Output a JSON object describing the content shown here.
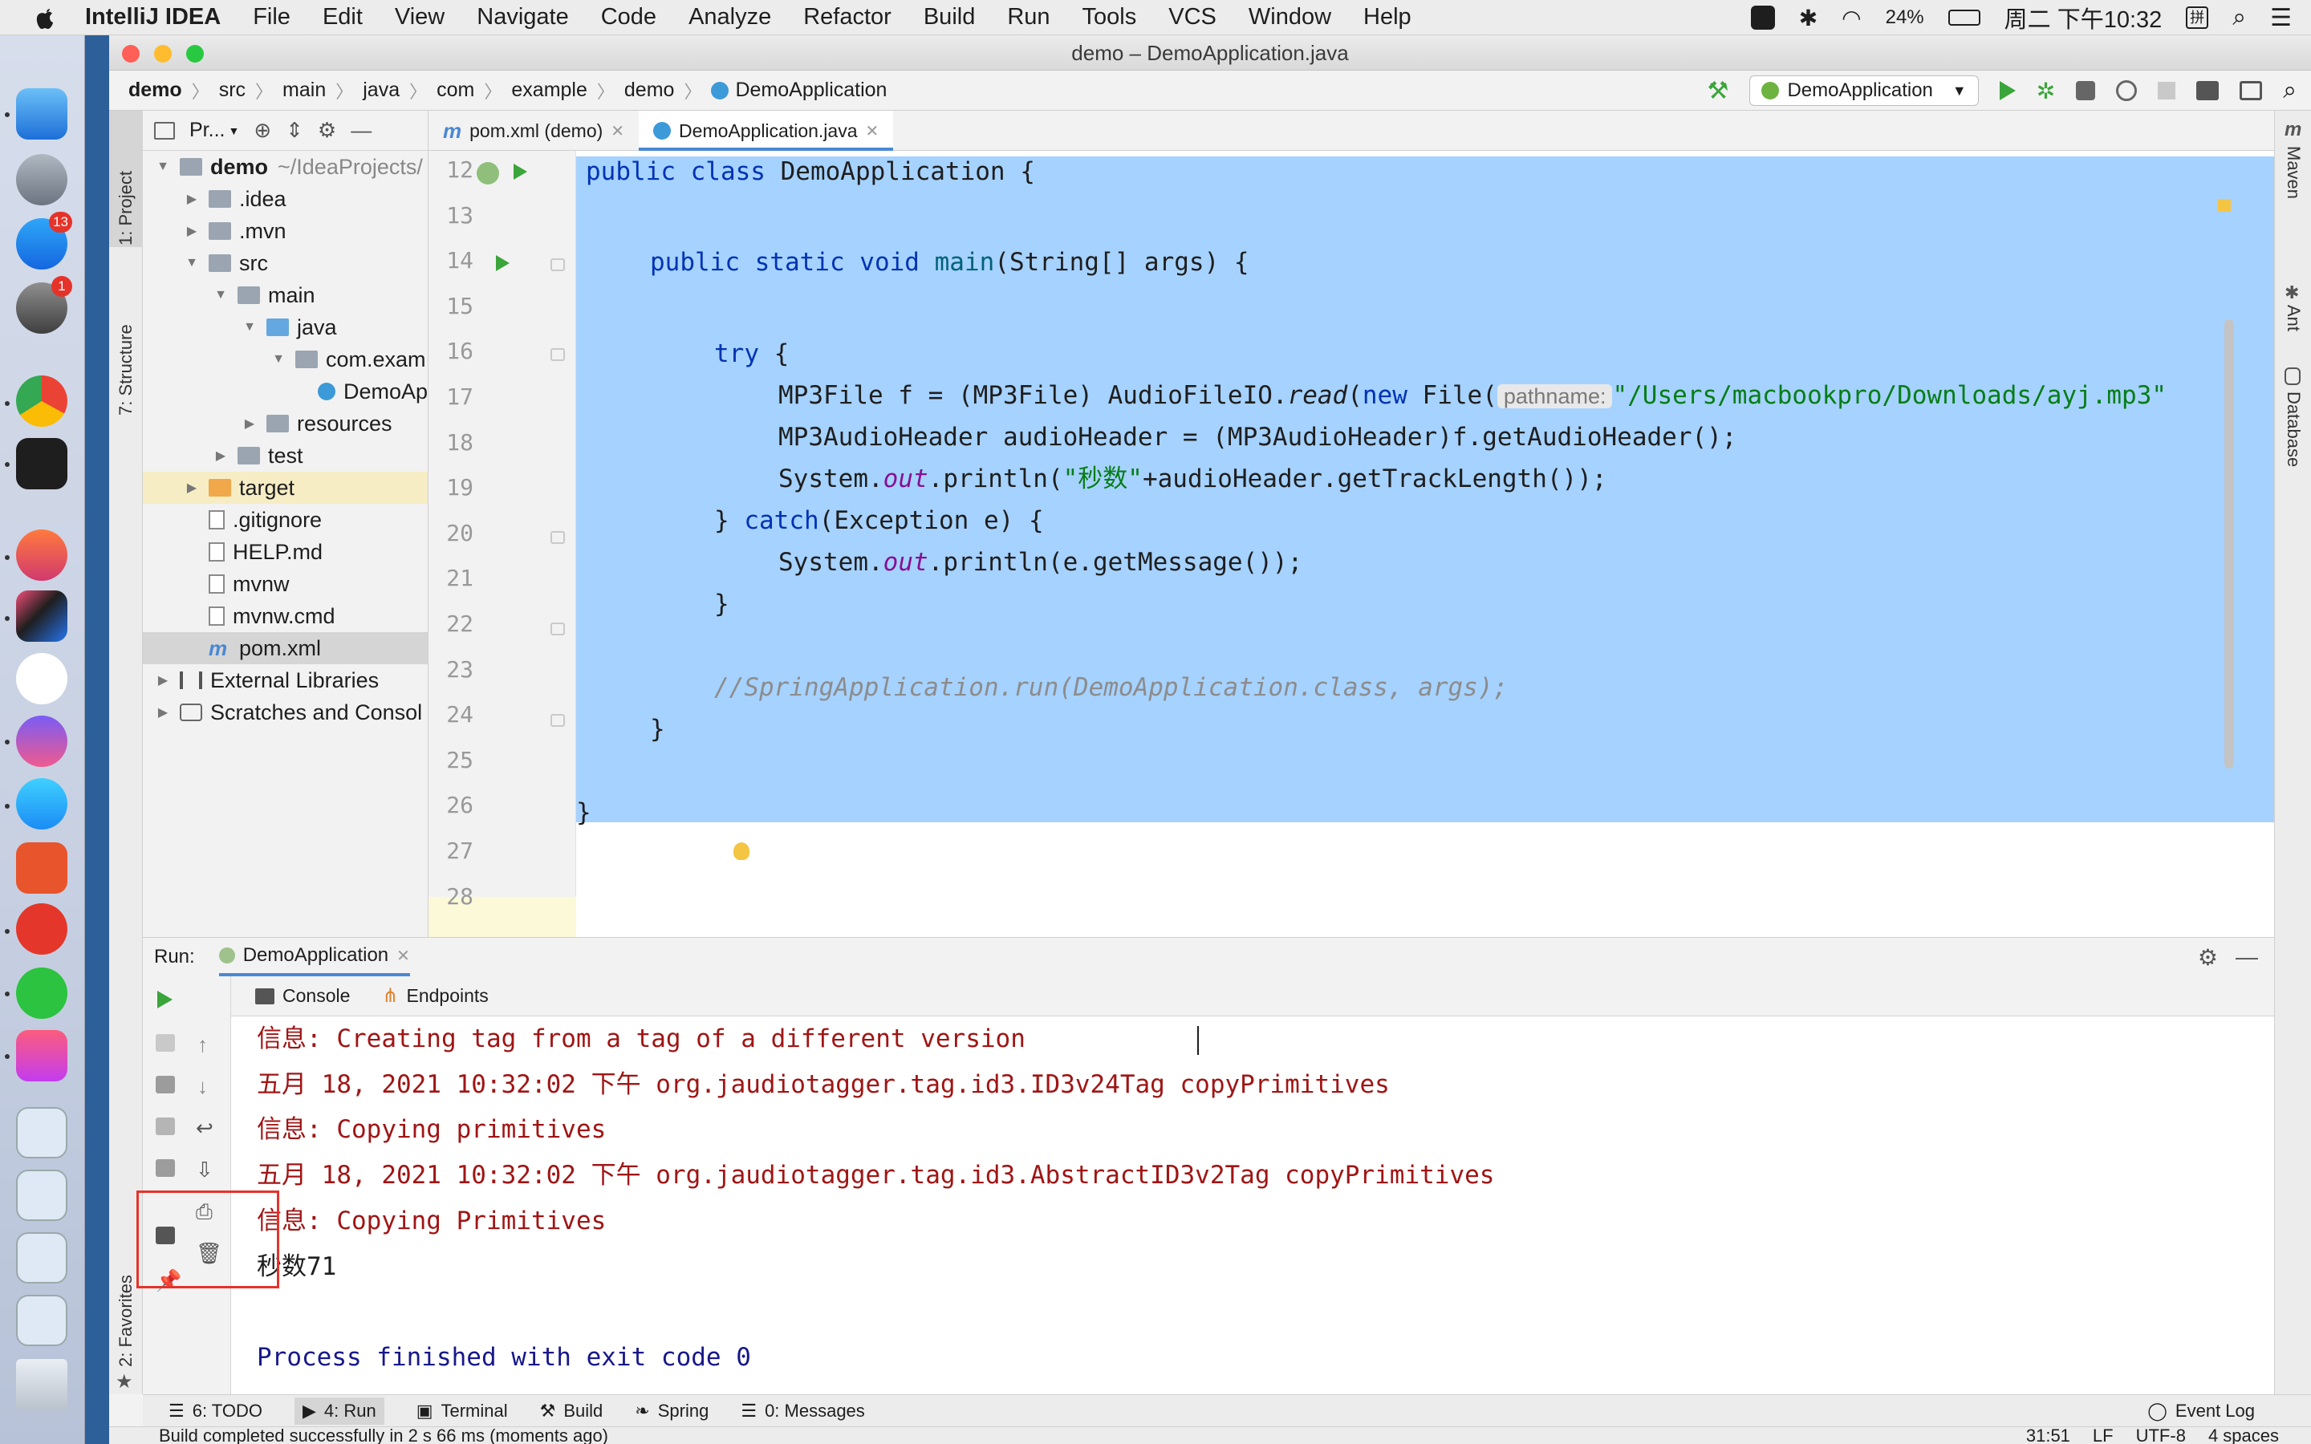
{
  "menubar": {
    "app_name": "IntelliJ IDEA",
    "items": [
      "File",
      "Edit",
      "View",
      "Navigate",
      "Code",
      "Analyze",
      "Refactor",
      "Build",
      "Run",
      "Tools",
      "VCS",
      "Window",
      "Help"
    ],
    "battery": "24%",
    "clock": "周二 下午10:32"
  },
  "dock": {
    "badges": {
      "appstore": "13",
      "prefs": "1"
    }
  },
  "window": {
    "title": "demo – DemoApplication.java"
  },
  "breadcrumbs": [
    "demo",
    "src",
    "main",
    "java",
    "com",
    "example",
    "demo",
    "DemoApplication"
  ],
  "toolbar": {
    "run_config": "DemoApplication"
  },
  "left_tools": {
    "project": "1: Project",
    "structure": "7: Structure",
    "favorites": "2: Favorites"
  },
  "right_tools": {
    "maven": "Maven",
    "ant": "Ant",
    "database": "Database"
  },
  "project": {
    "header": "Pr...",
    "tree": [
      {
        "label": "demo",
        "extra": "~/IdeaProjects/",
        "depth": 0,
        "arrow": "▼",
        "icon": "folder",
        "bold": true
      },
      {
        "label": ".idea",
        "depth": 1,
        "arrow": "▶",
        "icon": "folder"
      },
      {
        "label": ".mvn",
        "depth": 1,
        "arrow": "▶",
        "icon": "folder"
      },
      {
        "label": "src",
        "depth": 1,
        "arrow": "▼",
        "icon": "folder"
      },
      {
        "label": "main",
        "depth": 2,
        "arrow": "▼",
        "icon": "folder"
      },
      {
        "label": "java",
        "depth": 3,
        "arrow": "▼",
        "icon": "folder-blue"
      },
      {
        "label": "com.exam",
        "depth": 4,
        "arrow": "▼",
        "icon": "folder"
      },
      {
        "label": "DemoAp",
        "depth": 5,
        "arrow": "",
        "icon": "class"
      },
      {
        "label": "resources",
        "depth": 3,
        "arrow": "▶",
        "icon": "folder"
      },
      {
        "label": "test",
        "depth": 2,
        "arrow": "▶",
        "icon": "folder"
      },
      {
        "label": "target",
        "depth": 1,
        "arrow": "▶",
        "icon": "folder-orange",
        "state": "target"
      },
      {
        "label": ".gitignore",
        "depth": 1,
        "arrow": "",
        "icon": "file"
      },
      {
        "label": "HELP.md",
        "depth": 1,
        "arrow": "",
        "icon": "file"
      },
      {
        "label": "mvnw",
        "depth": 1,
        "arrow": "",
        "icon": "file"
      },
      {
        "label": "mvnw.cmd",
        "depth": 1,
        "arrow": "",
        "icon": "file"
      },
      {
        "label": "pom.xml",
        "depth": 1,
        "arrow": "",
        "icon": "maven",
        "state": "sel"
      },
      {
        "label": "External Libraries",
        "depth": 0,
        "arrow": "▶",
        "icon": "lib"
      },
      {
        "label": "Scratches and Consol",
        "depth": 0,
        "arrow": "▶",
        "icon": "scratch"
      }
    ]
  },
  "editor": {
    "tabs": [
      {
        "label": "pom.xml (demo)",
        "icon": "m",
        "active": false
      },
      {
        "label": "DemoApplication.java",
        "icon": "class",
        "active": true
      }
    ],
    "line_numbers": [
      "12",
      "13",
      "14",
      "15",
      "16",
      "17",
      "18",
      "19",
      "20",
      "21",
      "22",
      "23",
      "24",
      "25",
      "26",
      "27",
      "28"
    ],
    "code": {
      "l12": {
        "kw": "public class",
        "rest": " DemoApplication {"
      },
      "l14": {
        "kw": "public static void",
        "fn": "main",
        "rest": "(String[] args) {"
      },
      "l16": {
        "kw": "try",
        "rest": " {"
      },
      "l17": {
        "a": "MP3File f = (MP3File) AudioFileIO.",
        "read": "read",
        "b": "(",
        "new": "new",
        "c": " File(",
        "hint": "pathname:",
        "str": "\"/Users/macbookpro/Downloads/ayj.mp3\""
      },
      "l18": {
        "text": "MP3AudioHeader audioHeader = (MP3AudioHeader)f.getAudioHeader();"
      },
      "l19": {
        "a": "System.",
        "out": "out",
        "b": ".println(",
        "str": "\"秒数\"",
        "c": "+audioHeader.getTrackLength());"
      },
      "l20": {
        "a": "} ",
        "kw": "catch",
        "b": "(Exception e) {"
      },
      "l21": {
        "a": "System.",
        "out": "out",
        "b": ".println(e.getMessage());"
      },
      "l22": {
        "text": "}"
      },
      "l24": {
        "comment": "//SpringApplication.run(DemoApplication.class, args);"
      },
      "l25": {
        "text": "}"
      },
      "l27": {
        "text": "}"
      }
    }
  },
  "run": {
    "label": "Run:",
    "tab": "DemoApplication",
    "subtabs": {
      "console": "Console",
      "endpoints": "Endpoints"
    },
    "console_lines": [
      {
        "text": "信息: Creating tag from a tag of a different version",
        "color": "red"
      },
      {
        "text": "五月 18, 2021 10:32:02 下午 org.jaudiotagger.tag.id3.ID3v24Tag copyPrimitives",
        "color": "red"
      },
      {
        "text": "信息: Copying primitives",
        "color": "red"
      },
      {
        "text": "五月 18, 2021 10:32:02 下午 org.jaudiotagger.tag.id3.AbstractID3v2Tag copyPrimitives",
        "color": "red"
      },
      {
        "text": "信息: Copying Primitives",
        "color": "red"
      },
      {
        "text": "秒数71",
        "color": "black"
      },
      {
        "text": "",
        "color": "black"
      },
      {
        "text": "Process finished with exit code 0",
        "color": "blue"
      }
    ]
  },
  "bottom_tabs": {
    "todo": "6: TODO",
    "run": "4: Run",
    "terminal": "Terminal",
    "build": "Build",
    "spring": "Spring",
    "messages": "0: Messages",
    "event_log": "Event Log"
  },
  "status": {
    "message": "Build completed successfully in 2 s 66 ms (moments ago)",
    "position": "31:51",
    "line_sep": "LF",
    "encoding": "UTF-8",
    "indent": "4 spaces"
  },
  "colors": {
    "selection": "#a6d2ff",
    "keyword": "#0033b3",
    "string": "#067d17",
    "console_red": "#a01515",
    "console_blue": "#18188a",
    "highlight_box": "#e6332a"
  }
}
